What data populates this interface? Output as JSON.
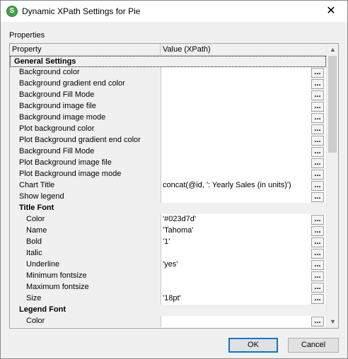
{
  "window": {
    "title": "Dynamic XPath Settings for Pie",
    "icon": "app-logo-icon",
    "icon_glyph": "S",
    "close_glyph": "✕"
  },
  "section_label": "Properties",
  "grid": {
    "headers": {
      "property": "Property",
      "value": "Value (XPath)"
    },
    "dots_label": "...",
    "rows": [
      {
        "type": "group",
        "level": 0,
        "name": "General Settings"
      },
      {
        "type": "prop",
        "level": 1,
        "name": "Background color",
        "value": ""
      },
      {
        "type": "prop",
        "level": 1,
        "name": "Background gradient end color",
        "value": ""
      },
      {
        "type": "prop",
        "level": 1,
        "name": "Background Fill Mode",
        "value": ""
      },
      {
        "type": "prop",
        "level": 1,
        "name": "Background image file",
        "value": ""
      },
      {
        "type": "prop",
        "level": 1,
        "name": "Background image mode",
        "value": ""
      },
      {
        "type": "prop",
        "level": 1,
        "name": "Plot background color",
        "value": ""
      },
      {
        "type": "prop",
        "level": 1,
        "name": "Plot Background gradient end color",
        "value": ""
      },
      {
        "type": "prop",
        "level": 1,
        "name": "Background Fill Mode",
        "value": ""
      },
      {
        "type": "prop",
        "level": 1,
        "name": "Plot Background image file",
        "value": ""
      },
      {
        "type": "prop",
        "level": 1,
        "name": "Plot Background image mode",
        "value": ""
      },
      {
        "type": "prop",
        "level": 1,
        "name": "Chart Title",
        "value": "concat(@id, ': Yearly Sales (in units)')"
      },
      {
        "type": "prop",
        "level": 1,
        "name": "Show legend",
        "value": ""
      },
      {
        "type": "group",
        "level": 1,
        "name": "Title Font"
      },
      {
        "type": "prop",
        "level": 2,
        "name": "Color",
        "value": "'#023d7d'"
      },
      {
        "type": "prop",
        "level": 2,
        "name": "Name",
        "value": "'Tahoma'"
      },
      {
        "type": "prop",
        "level": 2,
        "name": "Bold",
        "value": "'1'"
      },
      {
        "type": "prop",
        "level": 2,
        "name": "Italic",
        "value": ""
      },
      {
        "type": "prop",
        "level": 2,
        "name": "Underline",
        "value": "'yes'"
      },
      {
        "type": "prop",
        "level": 2,
        "name": "Minimum fontsize",
        "value": ""
      },
      {
        "type": "prop",
        "level": 2,
        "name": "Maximum fontsize",
        "value": ""
      },
      {
        "type": "prop",
        "level": 2,
        "name": "Size",
        "value": "'18pt'"
      },
      {
        "type": "group",
        "level": 1,
        "name": "Legend Font"
      },
      {
        "type": "prop",
        "level": 2,
        "name": "Color",
        "value": ""
      }
    ]
  },
  "scrollbar": {
    "up_glyph": "▲",
    "down_glyph": "▼",
    "position": 0
  },
  "buttons": {
    "ok": "OK",
    "cancel": "Cancel"
  },
  "colors": {
    "accent": "#0078d7",
    "icon_green": "#43a047"
  }
}
